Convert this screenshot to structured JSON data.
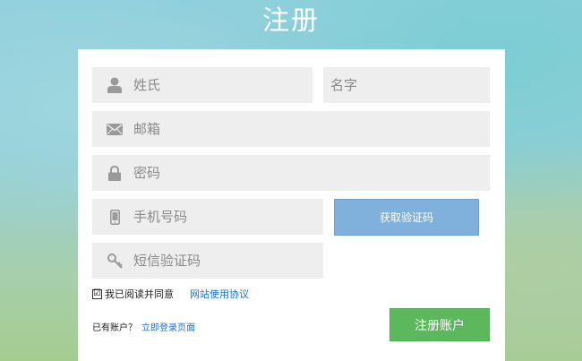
{
  "page": {
    "title": "注册"
  },
  "form": {
    "last_name_placeholder": "姓氏",
    "first_name_placeholder": "名字",
    "email_placeholder": "邮箱",
    "password_placeholder": "密码",
    "phone_placeholder": "手机号码",
    "sms_code_placeholder": "短信验证码",
    "get_code_label": "获取验证码",
    "agree_text": "我已阅读并同意",
    "agree_checked": true,
    "agree_checkmark": "☑",
    "terms_link": "网站使用协议",
    "has_account_text": "已有账户？",
    "login_link": "立即登录页面",
    "submit_label": "注册账户"
  },
  "colors": {
    "card_bg": "#ffffff",
    "field_bg": "#eeeeee",
    "code_button": "#80b1dc",
    "submit_button": "#5cb85c",
    "link": "#1a73c9"
  },
  "icons": {
    "last_name": "user-icon",
    "email": "envelope-icon",
    "password": "lock-icon",
    "phone": "mobile-phone-icon",
    "sms_code": "key-icon"
  }
}
